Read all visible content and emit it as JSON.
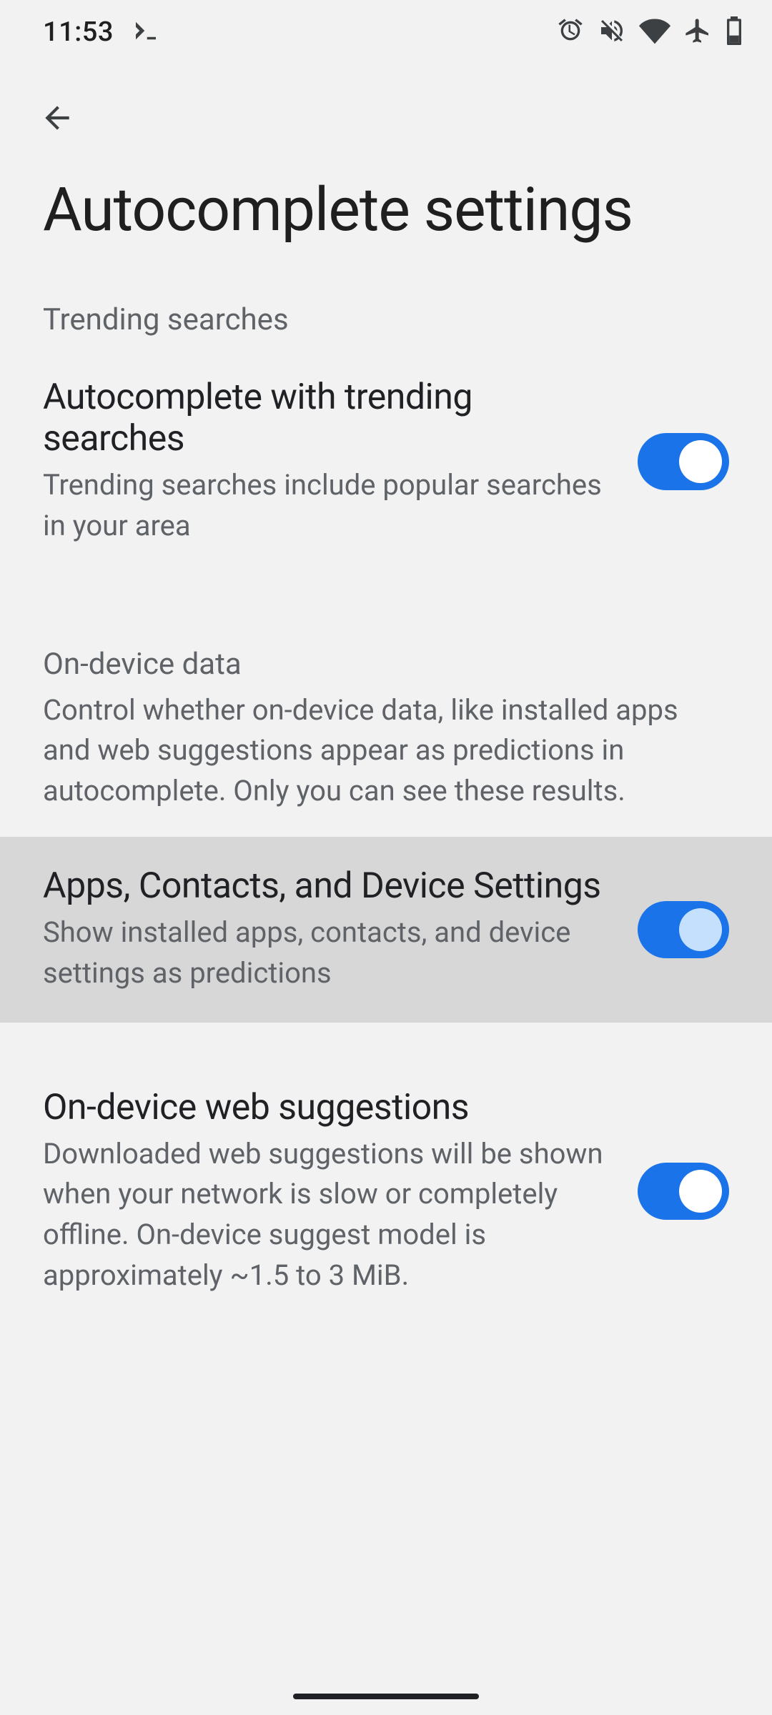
{
  "status": {
    "time": "11:53"
  },
  "page": {
    "title": "Autocomplete settings"
  },
  "sections": [
    {
      "title": "Trending searches",
      "desc": "",
      "items": [
        {
          "title": "Autocomplete with trending searches",
          "sub": "Trending searches include popular searches in your area",
          "on": true,
          "highlight": false
        }
      ]
    },
    {
      "title": "On-device data",
      "desc": "Control whether on-device data, like installed apps and web suggestions appear as predictions in autocomplete. Only you can see these results.",
      "items": [
        {
          "title": "Apps, Contacts, and Device Settings",
          "sub": "Show installed apps, contacts, and device settings as predictions",
          "on": true,
          "highlight": true
        },
        {
          "title": "On-device web suggestions",
          "sub": "Downloaded web suggestions will be shown when your network is slow or completely offline. On-device suggest model is approximately ~1.5 to 3 MiB.",
          "on": true,
          "highlight": false
        }
      ]
    }
  ]
}
